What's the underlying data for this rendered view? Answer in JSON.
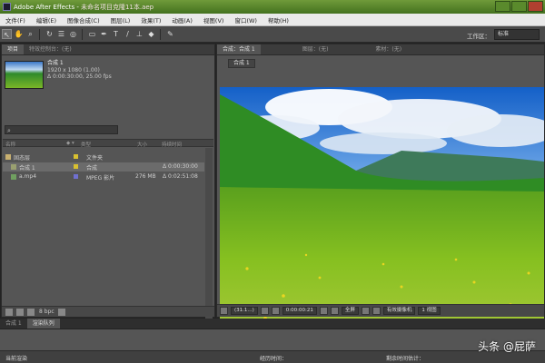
{
  "window": {
    "app_title": "Adobe After Effects -",
    "project_file": "未命名项目克隆11本.aep"
  },
  "menu": {
    "items": [
      "文件(F)",
      "编辑(E)",
      "图像合成(C)",
      "图层(L)",
      "效果(T)",
      "动画(A)",
      "视图(V)",
      "窗口(W)",
      "帮助(H)"
    ]
  },
  "toolbar": {
    "tools": [
      "arrow-tool-icon",
      "hand-tool-icon",
      "zoom-tool-icon",
      "rotate-tool-icon",
      "camera-tool-icon",
      "pan-behind-tool-icon",
      "mask-tool-icon",
      "pen-tool-icon",
      "type-tool-icon",
      "brush-tool-icon",
      "clone-tool-icon",
      "eraser-tool-icon",
      "roto-tool-icon"
    ],
    "workspace_label": "工作区：",
    "workspace_value": "标准"
  },
  "project_panel": {
    "tab_project": "项目",
    "tab_effects": "特效控制台：(无)",
    "comp_name": "合成 1",
    "comp_dims": "1920 x 1080 (1.00)",
    "comp_duration": "Δ 0:00:30:00, 25.00 fps",
    "columns": {
      "name": "名称",
      "type": "类型",
      "size": "大小",
      "duration": "持续时间"
    },
    "rows": [
      {
        "name": "固态层",
        "type": "文件夹",
        "size": "",
        "duration": "",
        "label_color": "#d8c030",
        "selected": false
      },
      {
        "name": "合成 1",
        "type": "合成",
        "size": "",
        "duration": "Δ 0:00:30:00",
        "label_color": "#d8c030",
        "selected": true
      },
      {
        "name": "a.mp4",
        "type": "MPEG 影片",
        "size": "276 MB",
        "duration": "Δ 0:02:51:08",
        "label_color": "#7070d0",
        "selected": false
      }
    ],
    "bpc": "8 bpc"
  },
  "composition_panel": {
    "tab_comp": "合成：合成 1",
    "tab_layer": "图层：(无)",
    "tab_footage": "素材：(无)",
    "subtab": "合成 1",
    "zoom": "(31.1...)",
    "timecode": "0:00:00:21",
    "resolution": "全屏",
    "camera": "有效摄像机",
    "views": "1 视图"
  },
  "timeline": {
    "tab_comp": "合成 1",
    "tab_render": "渲染队列",
    "current_render": "当前渲染",
    "elapsed": "经历时间：",
    "est_remain": "剩余时间估计："
  },
  "watermark": "头条 @屁萨",
  "colors": {
    "titlebar": "#5a8a2c",
    "panel_bg": "#555555",
    "accent_label_yellow": "#d8c030"
  }
}
